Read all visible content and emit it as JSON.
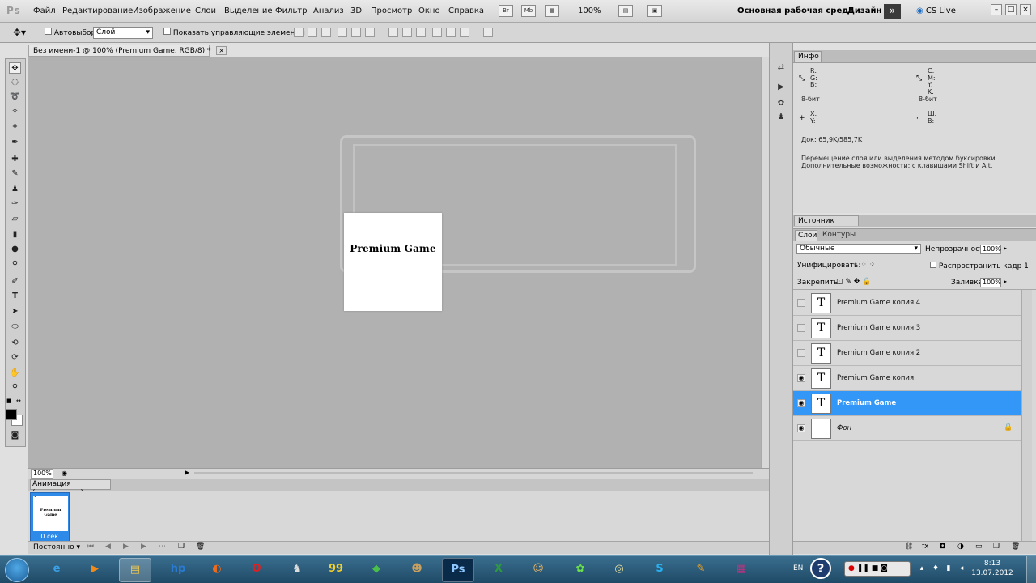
{
  "app": {
    "logo": "Ps"
  },
  "menu": [
    "Файл",
    "Редактирование",
    "Изображение",
    "Слои",
    "Выделение",
    "Фильтр",
    "Анализ",
    "3D",
    "Просмотр",
    "Окно",
    "Справка"
  ],
  "toolbar_right": {
    "br_label": "Br",
    "mb_label": "Mb",
    "zoom": "100%",
    "workspace": "Основная рабочая среда",
    "design": "Дизайн",
    "cslive": "CS Live",
    "window_controls": [
      "–",
      "□",
      "×"
    ]
  },
  "options_bar": {
    "autoselect_label": "Автовыбор:",
    "autoselect_value": "Слой",
    "show_controls_label": "Показать управляющие элементы"
  },
  "document": {
    "tab_title": "Без имени-1 @ 100% (Premium Game, RGB/8) *",
    "tab_close": "×",
    "canvas_text": "Premium Game",
    "zoom_status": "100%"
  },
  "animation": {
    "tab_label": "Анимация (покадровая)",
    "frame_number": "1",
    "frame_thumb_text": "Premium Game",
    "frame_delay": "0 сек.",
    "loop_option": "Постоянно"
  },
  "info_panel": {
    "tab_label": "Инфо",
    "rgb_labels": "R:\nG:\nB:",
    "cmyk_labels": "C:\nM:\nY:\nK:",
    "bit_left": "8-бит",
    "bit_right": "8-бит",
    "xy_labels": "X:\nY:",
    "wh_labels": "Ш:\nВ:",
    "doc_size": "Док: 65,9K/585,7K",
    "hint": "Перемещение слоя или выделения методом буксировки.\nДополнительные возможности: с клавишами Shift и Alt."
  },
  "clone_panel": {
    "tab_label": "Источник клонов"
  },
  "layers_panel": {
    "tab_layers": "Слои",
    "tab_paths": "Контуры",
    "blend_mode": "Обычные",
    "opacity_label": "Непрозрачность:",
    "opacity_value": "100%",
    "unify_label": "Унифицировать:",
    "propagate_label": "Распространить кадр 1",
    "lock_label": "Закрепить:",
    "fill_label": "Заливка:",
    "fill_value": "100%",
    "layers": [
      {
        "name": "Premium Game копия 4",
        "visible": false,
        "type": "text",
        "selected": false
      },
      {
        "name": "Premium Game копия 3",
        "visible": false,
        "type": "text",
        "selected": false
      },
      {
        "name": "Premium Game копия 2",
        "visible": false,
        "type": "text",
        "selected": false
      },
      {
        "name": "Premium Game копия",
        "visible": true,
        "type": "text",
        "selected": false
      },
      {
        "name": "Premium Game",
        "visible": true,
        "type": "text",
        "selected": true
      },
      {
        "name": "Фон",
        "visible": true,
        "type": "background",
        "selected": false
      }
    ]
  },
  "taskbar": {
    "lang": "EN",
    "help": "?",
    "time": "8:13",
    "date": "13.07.2012",
    "apps": [
      {
        "name": "ie",
        "glyph": "e"
      },
      {
        "name": "media-player",
        "glyph": "▶"
      },
      {
        "name": "explorer",
        "glyph": "▤"
      },
      {
        "name": "hp",
        "glyph": "hp"
      },
      {
        "name": "firefox-like",
        "glyph": "◐"
      },
      {
        "name": "opera",
        "glyph": "O"
      },
      {
        "name": "app-dark",
        "glyph": "♞"
      },
      {
        "name": "app-99",
        "glyph": "99"
      },
      {
        "name": "app-green",
        "glyph": "◆"
      },
      {
        "name": "app-game",
        "glyph": "☻"
      },
      {
        "name": "photoshop",
        "glyph": "Ps"
      },
      {
        "name": "excel",
        "glyph": "X"
      },
      {
        "name": "app-character",
        "glyph": "☺"
      },
      {
        "name": "icq",
        "glyph": "✿"
      },
      {
        "name": "app-circle",
        "glyph": "◎"
      },
      {
        "name": "skype",
        "glyph": "S"
      },
      {
        "name": "app-edit",
        "glyph": "✎"
      },
      {
        "name": "winrar",
        "glyph": "▦"
      }
    ]
  },
  "colors": {
    "selection": "#3297f7",
    "taskbar": "#1e4a66"
  }
}
